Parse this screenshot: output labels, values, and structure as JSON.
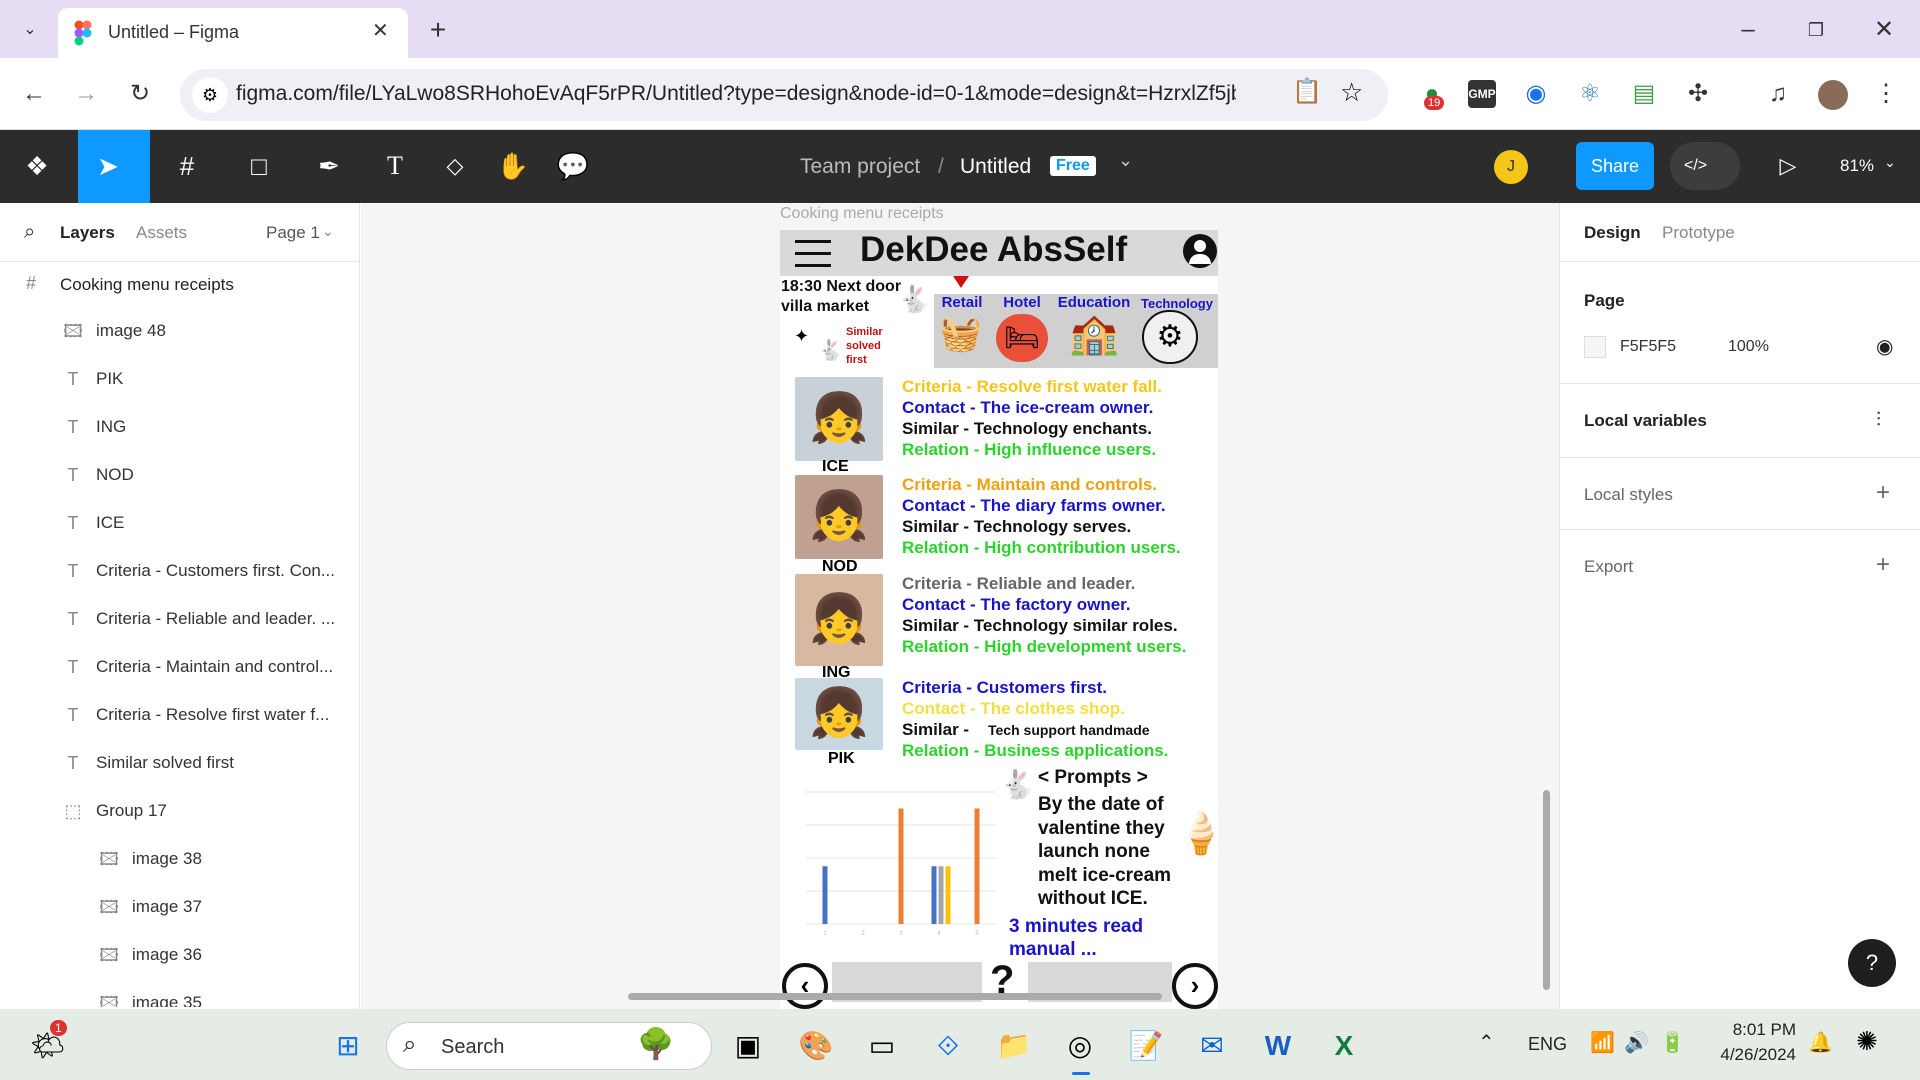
{
  "browser": {
    "tab_title": "Untitled – Figma",
    "url": "figma.com/file/LYaLwo8SRHohoEvAqF5rPR/Untitled?type=design&node-id=0-1&mode=design&t=HzrxlZf5jbU...",
    "ext_badge": "19"
  },
  "figma": {
    "breadcrumb_team": "Team project",
    "breadcrumb_sep": "/",
    "file_name": "Untitled",
    "plan_badge": "Free",
    "avatar_letter": "J",
    "share_label": "Share",
    "zoom": "81%"
  },
  "left_panel": {
    "tab_layers": "Layers",
    "tab_assets": "Assets",
    "page_select": "Page 1",
    "frame_name": "Cooking menu receipts",
    "layers": [
      {
        "name": "image 48",
        "kind": "image-icon"
      },
      {
        "name": "PIK",
        "kind": "text-icon"
      },
      {
        "name": "ING",
        "kind": "text-icon"
      },
      {
        "name": "NOD",
        "kind": "text-icon"
      },
      {
        "name": "ICE",
        "kind": "text-icon"
      },
      {
        "name": "Criteria - Customers first. Con...",
        "kind": "text-icon"
      },
      {
        "name": "Criteria - Reliable and leader. ...",
        "kind": "text-icon"
      },
      {
        "name": "Criteria - Maintain and control...",
        "kind": "text-icon"
      },
      {
        "name": "Criteria - Resolve first water f...",
        "kind": "text-icon"
      },
      {
        "name": "Similar solved first",
        "kind": "text-icon"
      },
      {
        "name": "Group 17",
        "kind": "group-icon"
      },
      {
        "name": "image 38",
        "kind": "image-icon"
      },
      {
        "name": "image 37",
        "kind": "image-icon"
      },
      {
        "name": "image 36",
        "kind": "image-icon"
      },
      {
        "name": "image 35",
        "kind": "image-icon"
      }
    ]
  },
  "canvas": {
    "frame_label": "Cooking menu receipts",
    "app_title": "DekDee AbsSelf",
    "header_text_1": "18:30 Next door",
    "header_text_2": "villa market",
    "similar_1": "Similar",
    "similar_2": "solved",
    "similar_3": "first",
    "categories": [
      "Retail",
      "Hotel",
      "Education",
      "Technology"
    ],
    "cards": [
      {
        "label": "ICE",
        "criteria": "Criteria  - Resolve first water fall.",
        "contact": "Contact - The ice-cream owner.",
        "similar": "Similar  -  Technology enchants.",
        "relation": "Relation -  High influence users.",
        "criteria_color": "#f5c518",
        "contact_color": "#1a14c8"
      },
      {
        "label": "NOD",
        "criteria": "Criteria  - Maintain and controls.",
        "contact": "Contact - The diary farms owner.",
        "similar": "Similar  -  Technology serves.",
        "relation": "Relation -  High contribution users.",
        "criteria_color": "#f0a010",
        "contact_color": "#1a14c8"
      },
      {
        "label": "ING",
        "criteria": "Criteria  - Reliable and leader.",
        "contact": "Contact - The factory owner.",
        "similar": "Similar  -  Technology similar roles.",
        "relation": "Relation -  High development users.",
        "criteria_color": "#666666",
        "contact_color": "#1a14c8"
      },
      {
        "label": "PIK",
        "criteria": "Criteria  - Customers first.",
        "contact": "Contact - The clothes shop.",
        "similar": "Similar  - ",
        "similar_small": "Tech support handmade",
        "relation": "Relation - Business applications.",
        "criteria_color": "#1a14c8",
        "contact_color": "#f0e040"
      }
    ],
    "prompts_title": "< Prompts >",
    "prompt_lines": [
      "By the date of",
      "valentine they",
      "launch none",
      "melt ice-cream",
      "without ICE."
    ],
    "read_more_1": "3 minutes read",
    "read_more_2": "manual ...",
    "question": "?"
  },
  "chart_data": {
    "type": "bar",
    "categories": [
      "1",
      "2",
      "3",
      "4",
      "5"
    ],
    "series": [
      {
        "values": [
          7,
          0,
          0,
          7,
          0
        ],
        "color": "#4472c4"
      },
      {
        "values": [
          0,
          0,
          0,
          7,
          0
        ],
        "color": "#a5a5a5"
      },
      {
        "values": [
          0,
          0,
          0,
          7,
          0
        ],
        "color": "#ffc000"
      },
      {
        "values": [
          0,
          0,
          14,
          0,
          14
        ],
        "color": "#ed7d31"
      }
    ],
    "ylim": [
      0,
      16
    ]
  },
  "right_panel": {
    "tab_design": "Design",
    "tab_prototype": "Prototype",
    "page_label": "Page",
    "page_color": "F5F5F5",
    "page_opacity": "100%",
    "local_variables": "Local variables",
    "local_styles": "Local styles",
    "export": "Export",
    "help": "?"
  },
  "taskbar": {
    "search_label": "Search",
    "weather_badge": "1",
    "lang": "ENG",
    "time": "8:01 PM",
    "date": "4/26/2024"
  },
  "colors": {
    "accent": "#0d99ff",
    "toolbar": "#2c2c2c",
    "tabstrip": "#e6dcf3"
  }
}
